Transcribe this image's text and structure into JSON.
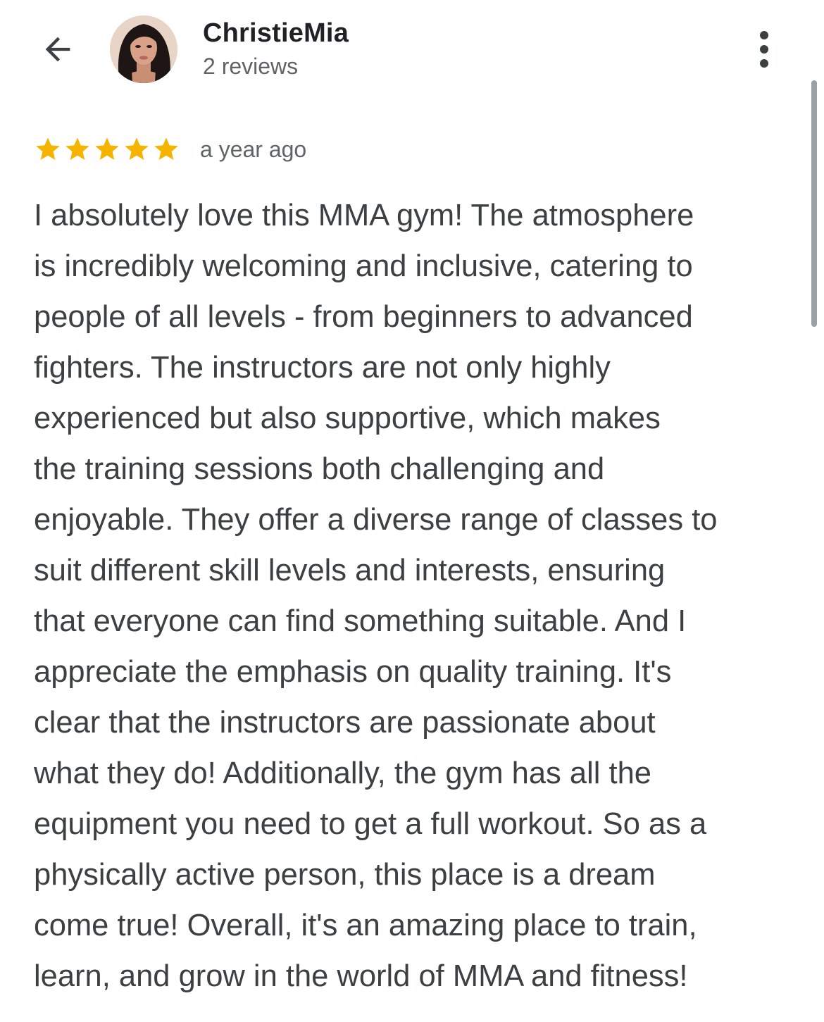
{
  "header": {
    "reviewer_name": "ChristieMia",
    "reviews_count": "2 reviews",
    "back_icon": "arrow-left-icon",
    "more_icon": "more-vertical-icon"
  },
  "review": {
    "rating": 5,
    "max_rating": 5,
    "star_color": "#f4b400",
    "time": "a year ago",
    "text": "I absolutely love this MMA gym! The atmosphere\nis incredibly welcoming and inclusive, catering to\npeople of all levels - from beginners to advanced\nfighters. The instructors are not only highly\nexperienced but also supportive, which makes\nthe training sessions both challenging and\nenjoyable. They offer a diverse range of classes to\nsuit different skill levels and interests, ensuring\nthat everyone can find something suitable. And I\nappreciate the emphasis on quality training. It's\nclear that the instructors are passionate about\nwhat they do! Additionally, the gym has all the\nequipment you need to get a full workout. So as a\nphysically active person, this place is a dream\ncome true! Overall, it's an amazing place to train,\nlearn, and grow in the world of MMA and fitness!"
  }
}
